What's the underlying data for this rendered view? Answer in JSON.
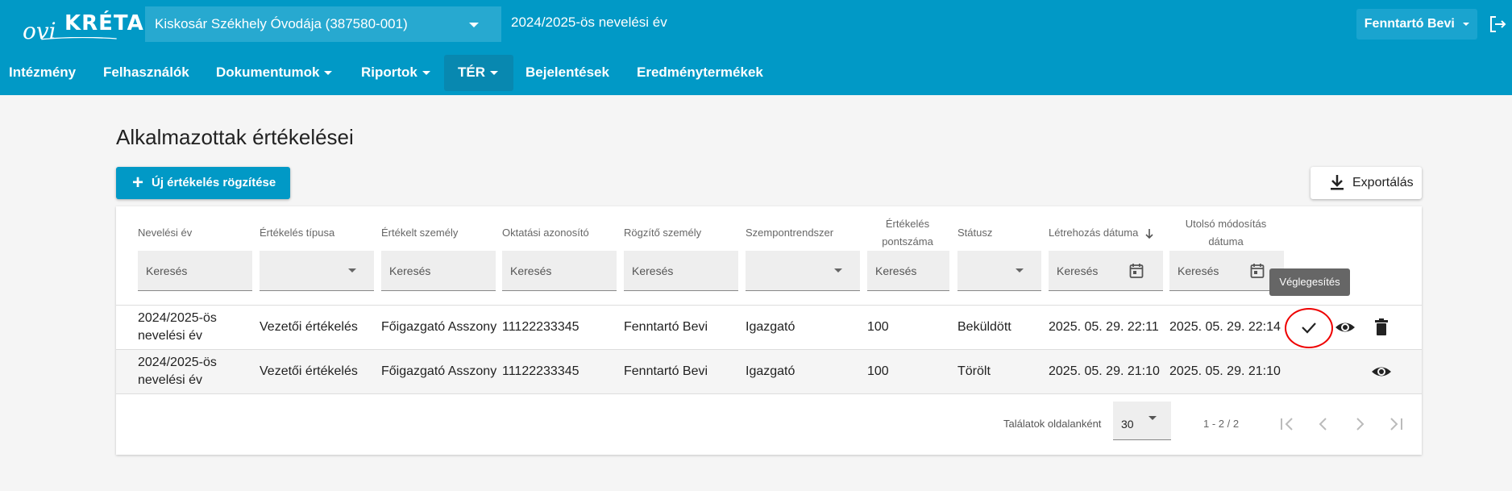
{
  "header": {
    "logo_prefix": "ovi",
    "logo_main": "KRÉTA",
    "institution": "Kiskosár Székhely Óvodája (387580-001)",
    "school_year": "2024/2025-ös nevelési év",
    "user": "Fenntartó Bevi"
  },
  "nav": [
    {
      "label": "Intézmény"
    },
    {
      "label": "Felhasználók"
    },
    {
      "label": "Dokumentumok"
    },
    {
      "label": "Riportok"
    },
    {
      "label": "TÉR"
    },
    {
      "label": "Bejelentések"
    },
    {
      "label": "Eredménytermékek"
    }
  ],
  "page": {
    "title": "Alkalmazottak értékelései",
    "add_button": "Új értékelés rögzítése",
    "export_button": "Exportálás"
  },
  "table": {
    "columns": [
      {
        "line1": "Nevelési év",
        "line2": ""
      },
      {
        "line1": "Értékelés típusa",
        "line2": ""
      },
      {
        "line1": "Értékelt személy",
        "line2": ""
      },
      {
        "line1": "Oktatási azonosító",
        "line2": ""
      },
      {
        "line1": "Rögzítő személy",
        "line2": ""
      },
      {
        "line1": "Szempontrendszer",
        "line2": ""
      },
      {
        "line1": "Értékelés",
        "line2": "pontszáma"
      },
      {
        "line1": "Státusz",
        "line2": ""
      },
      {
        "line1": "Létrehozás dátuma",
        "line2": ""
      },
      {
        "line1": "Utolsó módosítás",
        "line2": "dátuma"
      }
    ],
    "filter_placeholder": "Keresés",
    "rows": [
      {
        "year_line1": "2024/2025-ös",
        "year_line2": "nevelési év",
        "type": "Vezetői értékelés",
        "person": "Főigazgató Asszony",
        "edu_id": "11122233345",
        "recorder": "Fenntartó Bevi",
        "criteria": "Igazgató",
        "score": "100",
        "status": "Beküldött",
        "created": "2025. 05. 29. 22:11",
        "modified": "2025. 05. 29. 22:14"
      },
      {
        "year_line1": "2024/2025-ös",
        "year_line2": "nevelési év",
        "type": "Vezetői értékelés",
        "person": "Főigazgató Asszony",
        "edu_id": "11122233345",
        "recorder": "Fenntartó Bevi",
        "criteria": "Igazgató",
        "score": "100",
        "status": "Törölt",
        "created": "2025. 05. 29. 21:10",
        "modified": "2025. 05. 29. 21:10"
      }
    ],
    "tooltip": "Véglegesítés"
  },
  "pagination": {
    "per_page_label": "Találatok oldalanként",
    "per_page_value": "30",
    "range": "1 - 2 / 2"
  },
  "icons": {
    "add": "plus-icon",
    "export": "download-icon",
    "sort": "arrow-down-icon",
    "calendar": "calendar-icon",
    "finalize": "check-icon",
    "view": "eye-icon",
    "delete": "trash-icon",
    "logout": "logout-icon"
  },
  "colors": {
    "primary": "#0199c6",
    "highlight": "#e00000"
  }
}
